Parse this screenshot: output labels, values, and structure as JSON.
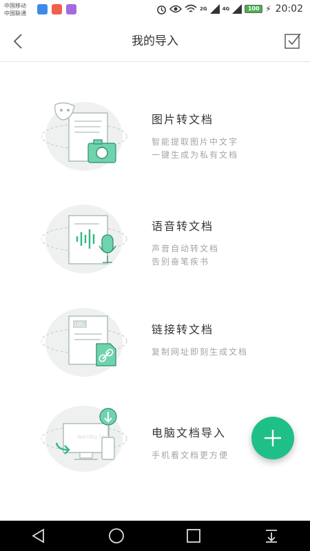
{
  "status_bar": {
    "carrier_line1": "中国移动",
    "carrier_line2": "中国联通",
    "signal_label_1": "2G",
    "signal_label_2": "4G",
    "battery": "100",
    "time": "20:02"
  },
  "header": {
    "title": "我的导入"
  },
  "items": [
    {
      "title": "图片转文档",
      "desc_line1": "智能提取图片中文字",
      "desc_line2": "一键生成为私有文档",
      "icon": "camera-icon"
    },
    {
      "title": "语音转文档",
      "desc_line1": "声音自动转文档",
      "desc_line2": "告别奋笔疾书",
      "icon": "microphone-icon"
    },
    {
      "title": "链接转文档",
      "desc_line1": "复制网址即刻生成文档",
      "desc_line2": "",
      "icon": "link-icon",
      "badge": "URL"
    },
    {
      "title": "电脑文档导入",
      "desc_line1": "手机看文档更方便",
      "desc_line2": "",
      "icon": "computer-icon",
      "screen_text": "wenku.lo"
    }
  ],
  "colors": {
    "accent": "#1fbf88",
    "illustration_bg": "#eef1f0"
  }
}
